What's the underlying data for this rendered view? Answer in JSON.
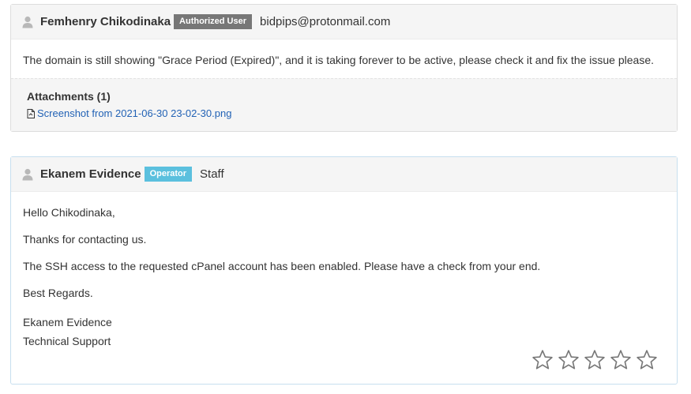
{
  "client_message": {
    "name": "Femhenry Chikodinaka",
    "badge": "Authorized User",
    "email": "bidpips@protonmail.com",
    "body": "The domain is still showing \"Grace Period (Expired)\", and it is taking forever to be active, please check it and fix the issue please.",
    "attachments_title": "Attachments (1)",
    "attachments": [
      {
        "filename": "Screenshot from 2021-06-30 23-02-30.png"
      }
    ]
  },
  "staff_message": {
    "name": "Ekanem Evidence",
    "badge": "Operator",
    "role": "Staff",
    "greeting": "Hello Chikodinaka,",
    "line1": "Thanks for contacting us.",
    "line2": "The SSH access to the requested cPanel account has been enabled. Please have a check from your end.",
    "closing": "Best Regards.",
    "signature_name": "Ekanem Evidence",
    "signature_title": "Technical Support"
  },
  "rating": {
    "max_stars": 5,
    "selected": 0
  },
  "colors": {
    "badge_authorized": "#777777",
    "badge_operator": "#5bc0de",
    "link": "#2262b5",
    "star_outline": "#777777"
  }
}
